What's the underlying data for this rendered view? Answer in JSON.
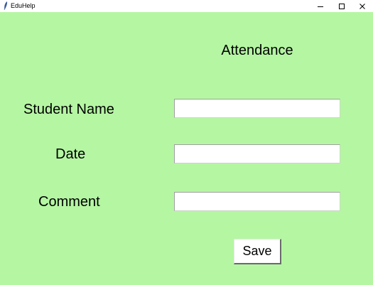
{
  "window": {
    "title": "EduHelp",
    "background_color": "#b5f6a3",
    "controls": {
      "minimize_icon": "minimize-icon",
      "maximize_icon": "maximize-icon",
      "close_icon": "close-icon"
    }
  },
  "form": {
    "heading": "Attendance",
    "fields": [
      {
        "label": "Student Name",
        "value": "",
        "placeholder": ""
      },
      {
        "label": "Date",
        "value": "",
        "placeholder": ""
      },
      {
        "label": "Comment",
        "value": "",
        "placeholder": ""
      }
    ],
    "save_label": "Save"
  }
}
